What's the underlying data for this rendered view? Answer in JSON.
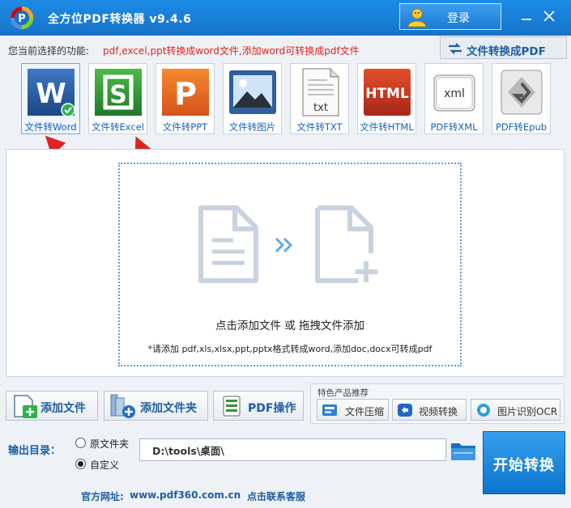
{
  "app": {
    "title": "全方位PDF转换器 v9.4.6",
    "login_label": "登录",
    "accent": "#1b7bd2"
  },
  "function_bar": {
    "label": "您当前选择的功能:",
    "value": "pdf,excel,ppt转换成word文件,添加word可转换成pdf文件",
    "convert_to_pdf_label": "文件转换成PDF"
  },
  "tools": [
    {
      "label": "文件转Word",
      "icon": "word-icon",
      "selected": true
    },
    {
      "label": "文件转Excel",
      "icon": "excel-icon",
      "selected": false
    },
    {
      "label": "文件转PPT",
      "icon": "ppt-icon",
      "selected": false
    },
    {
      "label": "文件转图片",
      "icon": "image-icon",
      "selected": false
    },
    {
      "label": "文件转TXT",
      "icon": "txt-icon",
      "selected": false
    },
    {
      "label": "文件转HTML",
      "icon": "html-icon",
      "selected": false
    },
    {
      "label": "PDF转XML",
      "icon": "xml-icon",
      "selected": false
    },
    {
      "label": "PDF转Epub",
      "icon": "epub-icon",
      "selected": false
    }
  ],
  "drop_zone": {
    "main_text": "点击添加文件 或 拖拽文件添加",
    "note": "*请添加 pdf,xls,xlsx,ppt,pptx格式转成word,添加doc,docx可转成pdf"
  },
  "actions": {
    "add_file": "添加文件",
    "add_folder": "添加文件夹",
    "pdf_ops": "PDF操作"
  },
  "featured": {
    "header": "特色产品推荐",
    "items": [
      "文件压缩",
      "视频转换",
      "图片识别OCR"
    ]
  },
  "output": {
    "label": "输出目录：",
    "option_source": "原文件夹",
    "option_custom": "自定义",
    "selected": "自定义",
    "path": "D:\\tools\\桌面\\"
  },
  "start_label": "开始转换",
  "footer": {
    "site_label": "官方网址:",
    "site": "www.pdf360.com.cn",
    "contact": "点击联系客服"
  }
}
